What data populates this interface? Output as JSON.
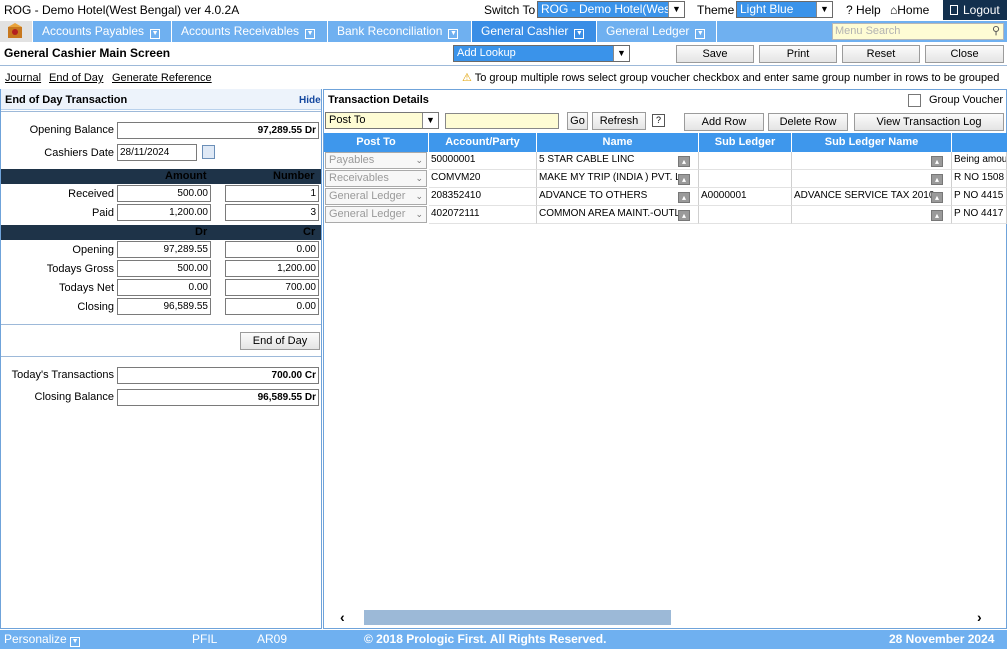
{
  "titlebar": {
    "app_title": "ROG - Demo Hotel(West Bengal) ver 4.0.2A",
    "switch_label": "Switch To",
    "switch_value": "ROG - Demo Hotel(West",
    "theme_label": "Theme",
    "theme_value": "Light Blue",
    "help": "Help",
    "home": "Home",
    "logout": "Logout"
  },
  "nav": {
    "tabs": [
      "Accounts Payables",
      "Accounts Receivables",
      "Bank Reconciliation",
      "General Cashier",
      "General Ledger"
    ],
    "active": "General Cashier",
    "search_placeholder": "Menu Search"
  },
  "screen": {
    "title": "General Cashier Main Screen",
    "lookup": "Add Lookup",
    "buttons": [
      "Save",
      "Print",
      "Reset",
      "Close"
    ]
  },
  "links": [
    "Journal",
    "End of Day",
    "Generate Reference"
  ],
  "notice": "To group multiple rows select group voucher checkbox and enter same group number in rows to be grouped",
  "eod": {
    "title": "End of Day Transaction",
    "hide": "Hide",
    "opening_balance_label": "Opening Balance",
    "opening_balance": "97,289.55 Dr",
    "cashiers_date_label": "Cashiers Date",
    "cashiers_date": "28/11/2024",
    "amount_hdr": "Amount",
    "number_hdr": "Number",
    "received_label": "Received",
    "received_amount": "500.00",
    "received_number": "1",
    "paid_label": "Paid",
    "paid_amount": "1,200.00",
    "paid_number": "3",
    "dr_hdr": "Dr",
    "cr_hdr": "Cr",
    "opening_label": "Opening",
    "opening_dr": "97,289.55",
    "opening_cr": "0.00",
    "gross_label": "Todays Gross",
    "gross_dr": "500.00",
    "gross_cr": "1,200.00",
    "net_label": "Todays Net",
    "net_dr": "0.00",
    "net_cr": "700.00",
    "closing_label": "Closing",
    "closing_dr": "96,589.55",
    "closing_cr": "0.00",
    "end_of_day_button": "End of Day",
    "todays_tx_label": "Today's Transactions",
    "todays_tx": "700.00 Cr",
    "closing_balance_label": "Closing Balance",
    "closing_balance": "96,589.55 Dr"
  },
  "tx": {
    "title": "Transaction Details",
    "group_voucher": "Group Voucher",
    "post_to": "Post To",
    "go": "Go",
    "refresh": "Refresh",
    "add_row": "Add Row",
    "delete_row": "Delete Row",
    "view_log": "View Transaction Log",
    "columns": [
      "Post To",
      "Account/Party",
      "Name",
      "Sub Ledger",
      "Sub Ledger Name",
      ""
    ],
    "rows": [
      {
        "post_to": "Payables",
        "account": "50000001",
        "name": "5 STAR CABLE LINC",
        "sub_ledger": "",
        "sub_ledger_name": "",
        "narration": "Being amou"
      },
      {
        "post_to": "Receivables",
        "account": "COMVM20",
        "name": "MAKE MY TRIP (INDIA ) PVT. L",
        "sub_ledger": "",
        "sub_ledger_name": "",
        "narration": "R NO 1508"
      },
      {
        "post_to": "General Ledger",
        "account": "208352410",
        "name": "ADVANCE TO OTHERS",
        "sub_ledger": "A0000001",
        "sub_ledger_name": "ADVANCE SERVICE TAX 2010",
        "narration": "P NO 4415"
      },
      {
        "post_to": "General Ledger",
        "account": "402072111",
        "name": "COMMON AREA MAINT.-OUTL",
        "sub_ledger": "",
        "sub_ledger_name": "",
        "narration": "P NO 4417"
      }
    ]
  },
  "footer": {
    "personalize": "Personalize",
    "code1": "PFIL",
    "code2": "AR09",
    "copyright": "© 2018 Prologic First. All Rights Reserved.",
    "date": "28 November 2024"
  },
  "colors": {
    "accent": "#3a93ea",
    "nav": "#6fb0f0",
    "dark": "#1e3348"
  }
}
